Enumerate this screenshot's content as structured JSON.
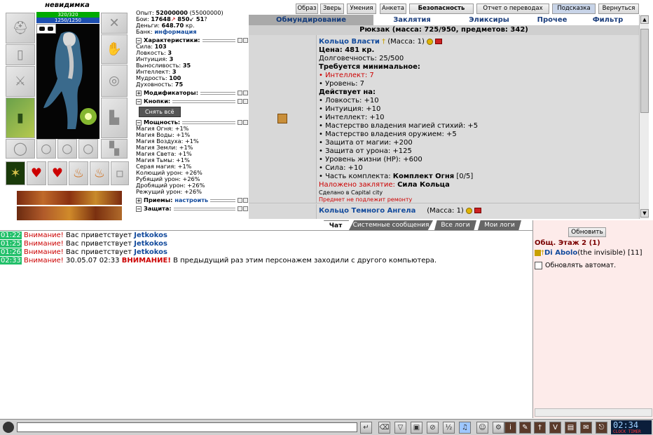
{
  "character": {
    "name": "невидимка",
    "hp": "320/320",
    "mp": "1250/1250"
  },
  "stats": {
    "exp_label": "Опыт:",
    "exp_value": "52000000",
    "exp_next": "(55000000)",
    "fights_label": "Бои:",
    "fights_win": "17648",
    "fights_lose": "850",
    "fights_draw": "51",
    "money_label": "Деньги:",
    "money_value": "648.70",
    "money_unit": "кр.",
    "bank_label": "Банк:",
    "bank_link": "информация",
    "sections": {
      "characteristics": "Характеристики:",
      "modifiers": "Модификаторы:",
      "buttons": "Кнопки:",
      "powers": "Мощность:",
      "tricks": "Приемы:",
      "tricks_link": "настроить",
      "protection": "Защита:"
    },
    "remove_all": "Снять всё",
    "chars": [
      {
        "label": "Сила:",
        "value": "103"
      },
      {
        "label": "Ловкость:",
        "value": "3"
      },
      {
        "label": "Интуиция:",
        "value": "3"
      },
      {
        "label": "Выносливость:",
        "value": "35"
      },
      {
        "label": "Интеллект:",
        "value": "3"
      },
      {
        "label": "Мудрость:",
        "value": "100"
      },
      {
        "label": "Духовность:",
        "value": "75"
      }
    ],
    "powers_list": [
      "Магия Огня: +1%",
      "Магия Воды: +1%",
      "Магия Воздуха: +1%",
      "Магия Земли: +1%",
      "Магия Света: +1%",
      "Магия Тьмы: +1%",
      "Серая магия: +1%",
      "Колющий урон: +26%",
      "Рубящий урон: +26%",
      "Дробящий урон: +26%",
      "Режущий урон: +26%"
    ]
  },
  "top_buttons": [
    "Образ",
    "Зверь",
    "Умения",
    "Анкета",
    "Безопасность",
    "Отчет о переводах",
    "Подсказка",
    "Вернуться"
  ],
  "tabs": [
    "Обмундирование",
    "Заклятия",
    "Эликсиры",
    "Прочее",
    "Фильтр"
  ],
  "backpack": "Рюкзак (масса: 725/950, предметов: 342)",
  "items": [
    {
      "name": "Кольцо Власти",
      "mass": "(Масса: 1)",
      "price": "Цена: 481 кр.",
      "durability": "Долговечность: 25/500",
      "req_title": "Требуется минимальное:",
      "req": [
        {
          "text": "• Интеллект: 7",
          "red": true
        },
        {
          "text": "• Уровень: 7",
          "red": false
        }
      ],
      "acts_title": "Действует на:",
      "acts": [
        "• Ловкость: +10",
        "• Интуиция: +10",
        "• Интеллект: +10",
        "• Мастерство владения магией стихий: +5",
        "• Мастерство владения оружием: +5",
        "• Защита от магии: +200",
        "• Защита от урона: +125",
        "• Уровень жизни (HP): +600",
        "• Сила: +10"
      ],
      "set_label": "• Часть комплекта:",
      "set_name": "Комплект Огня",
      "set_count": "[0/5]",
      "ench_label": "Наложено заклятие:",
      "ench_name": "Сила Кольца",
      "made": "Сделано в Capital city",
      "no_repair": "Предмет не подлежит ремонту"
    },
    {
      "name": "Кольцо Темного Ангела",
      "mass": "(Масса: 1)"
    }
  ],
  "chat_tabs": [
    "Чат",
    "Системные сообщения",
    "Все логи",
    "Мои логи"
  ],
  "chat_messages": [
    {
      "time": "01:22",
      "warn": "Внимание!",
      "text": "Вас приветствует",
      "nick": "Jetkokos"
    },
    {
      "time": "01:25",
      "warn": "Внимание!",
      "text": "Вас приветствует",
      "nick": "Jetkokos"
    },
    {
      "time": "01:26",
      "warn": "Внимание!",
      "text": "Вас приветствует",
      "nick": "Jetkokos"
    },
    {
      "time": "02:33",
      "warn": "Внимание!",
      "text": "30.05.07 02:33",
      "alert": "ВНИМАНИЕ!",
      "rest": "В предыдущий раз этим персонажем заходили с другого компьютера."
    }
  ],
  "right_panel": {
    "refresh": "Обновить",
    "floor": "Общ. Этаж 2 (1)",
    "user_name": "Di Abolo",
    "user_note": "(the invisible)",
    "user_level": "[11]",
    "auto_refresh": "Обновлять автомат."
  },
  "clock": {
    "time": "02:34",
    "sub": "CLOCK TIMER"
  },
  "colors": {
    "accent": "#124a9c",
    "warn": "#cc0000",
    "timestamp": "#22c06a"
  }
}
